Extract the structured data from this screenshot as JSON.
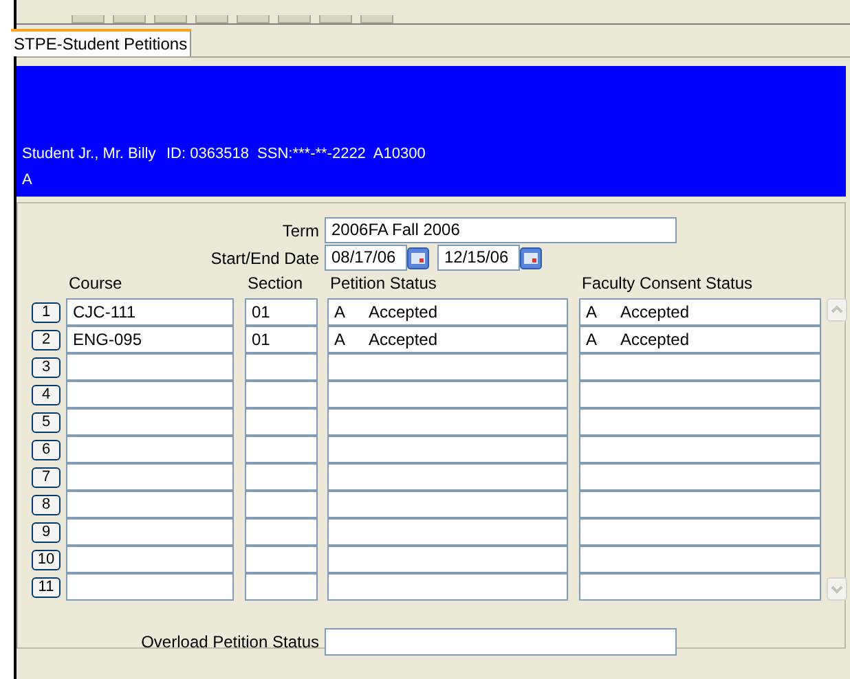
{
  "tabs": [
    {
      "label": "STPE-Student Petitions",
      "selected": true
    }
  ],
  "header": {
    "name": "Student Jr., Mr. Billy",
    "id_line": "ID: 0363518  SSN:***-**-2222  A10300",
    "line_2": "A"
  },
  "term": {
    "label": "Term",
    "value": "2006FA  Fall 2006"
  },
  "dates": {
    "label": "Start/End Date",
    "start": "08/17/06",
    "end": "12/15/06"
  },
  "table": {
    "columns": [
      "Course",
      "Section",
      "Petition Status",
      "Faculty Consent Status"
    ],
    "rows": [
      {
        "number": "1",
        "course": "CJC-111",
        "section": "01",
        "petition_code": "A",
        "petition_status": "Accepted",
        "consent_code": "A",
        "consent_status": "Accepted"
      },
      {
        "number": "2",
        "course": "ENG-095",
        "section": "01",
        "petition_code": "A",
        "petition_status": "Accepted",
        "consent_code": "A",
        "consent_status": "Accepted"
      },
      {
        "number": "3"
      },
      {
        "number": "4"
      },
      {
        "number": "5"
      },
      {
        "number": "6"
      },
      {
        "number": "7"
      },
      {
        "number": "8"
      },
      {
        "number": "9"
      },
      {
        "number": "10"
      },
      {
        "number": "11"
      }
    ]
  },
  "overload": {
    "label": "Overload Petition Status"
  }
}
